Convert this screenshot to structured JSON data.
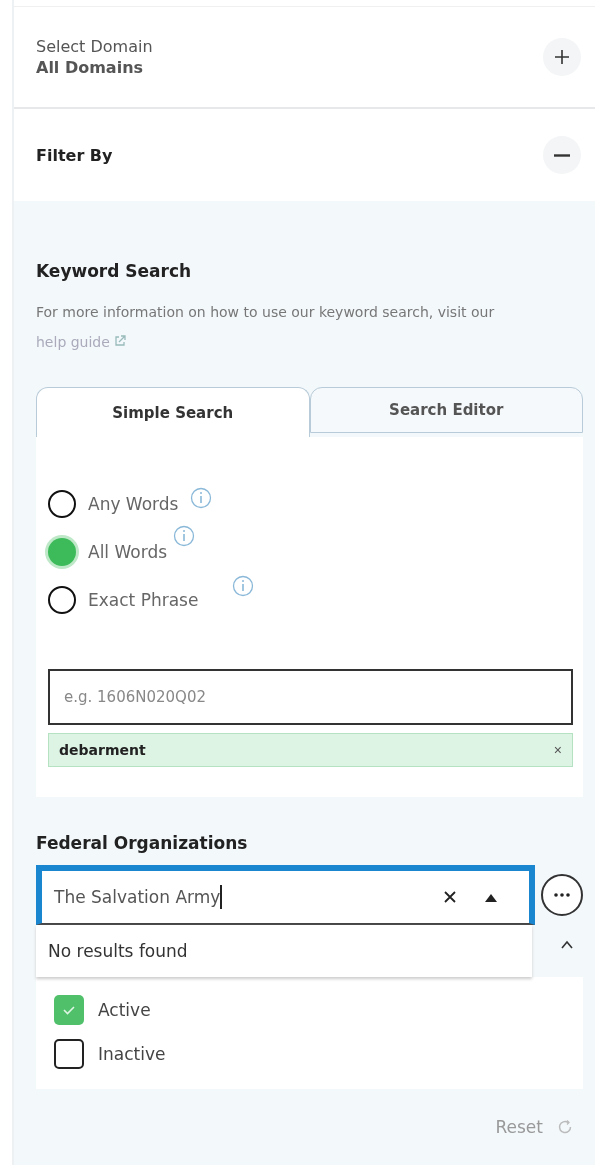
{
  "sections": [
    {
      "label": "Select Domain",
      "value": "All Domains",
      "expanded": false
    },
    {
      "label": "Filter By",
      "expanded": true
    }
  ],
  "keyword_search": {
    "title": "Keyword Search",
    "help_text": "For more information on how to use our keyword search, visit our",
    "help_link": "help guide",
    "tabs": [
      {
        "label": "Simple Search",
        "selected": true
      },
      {
        "label": "Search Editor",
        "selected": false
      }
    ],
    "options": [
      {
        "label": "Any Words",
        "selected": false
      },
      {
        "label": "All Words",
        "selected": true
      },
      {
        "label": "Exact Phrase",
        "selected": false
      }
    ],
    "input": {
      "placeholder": "e.g. 1606N020Q02"
    },
    "chips": [
      {
        "label": "debarment",
        "remove": "×"
      }
    ]
  },
  "federal_organizations": {
    "title": "Federal Organizations",
    "value": "The Salvation Army",
    "focused": true,
    "expanded": true,
    "message": "No results found",
    "statuses": [
      {
        "label": "Active",
        "checked": true
      },
      {
        "label": "Inactive",
        "checked": false
      }
    ]
  },
  "reset": "Reset"
}
